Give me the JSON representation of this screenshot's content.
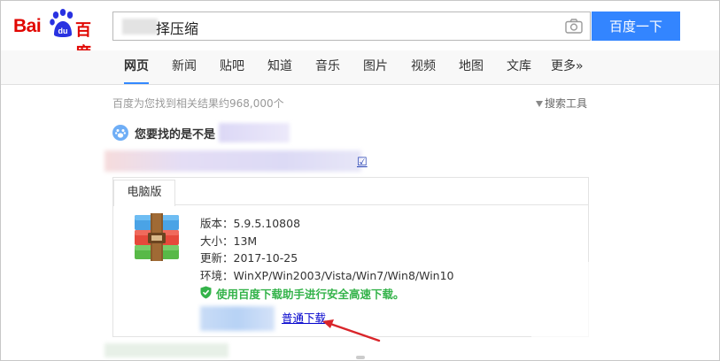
{
  "header": {
    "logo_bai": "Bai",
    "logo_du": "du",
    "logo_baidu": "百度",
    "query_visible_text": "择压缩",
    "search_button": "百度一下",
    "icons": {
      "camera": "camera-icon"
    }
  },
  "nav": {
    "items": [
      {
        "label": "网页",
        "active": true
      },
      {
        "label": "新闻"
      },
      {
        "label": "贴吧"
      },
      {
        "label": "知道"
      },
      {
        "label": "音乐"
      },
      {
        "label": "图片"
      },
      {
        "label": "视频"
      },
      {
        "label": "地图"
      },
      {
        "label": "文库"
      },
      {
        "label": "更多»"
      }
    ]
  },
  "results": {
    "count_text": "百度为您找到相关结果约968,000个",
    "search_tools": "搜索工具",
    "did_you_mean": "您要找的是不是",
    "title_tail": "☑"
  },
  "card": {
    "tab_label": "电脑版",
    "version": "版本：5.9.5.10808",
    "size": "大小：13M",
    "updated": "更新：2017-10-25",
    "env": "环境：WinXP/Win2003/Vista/Win7/Win8/Win10",
    "safe_download": "使用百度下载助手进行安全高速下载。",
    "normal_download": "普通下载"
  },
  "colors": {
    "brand_red": "#e10601",
    "brand_blue": "#3385ff",
    "safe_green": "#34b34a",
    "link_blue": "#0000cc",
    "annotation_arrow": "#d9252a"
  }
}
